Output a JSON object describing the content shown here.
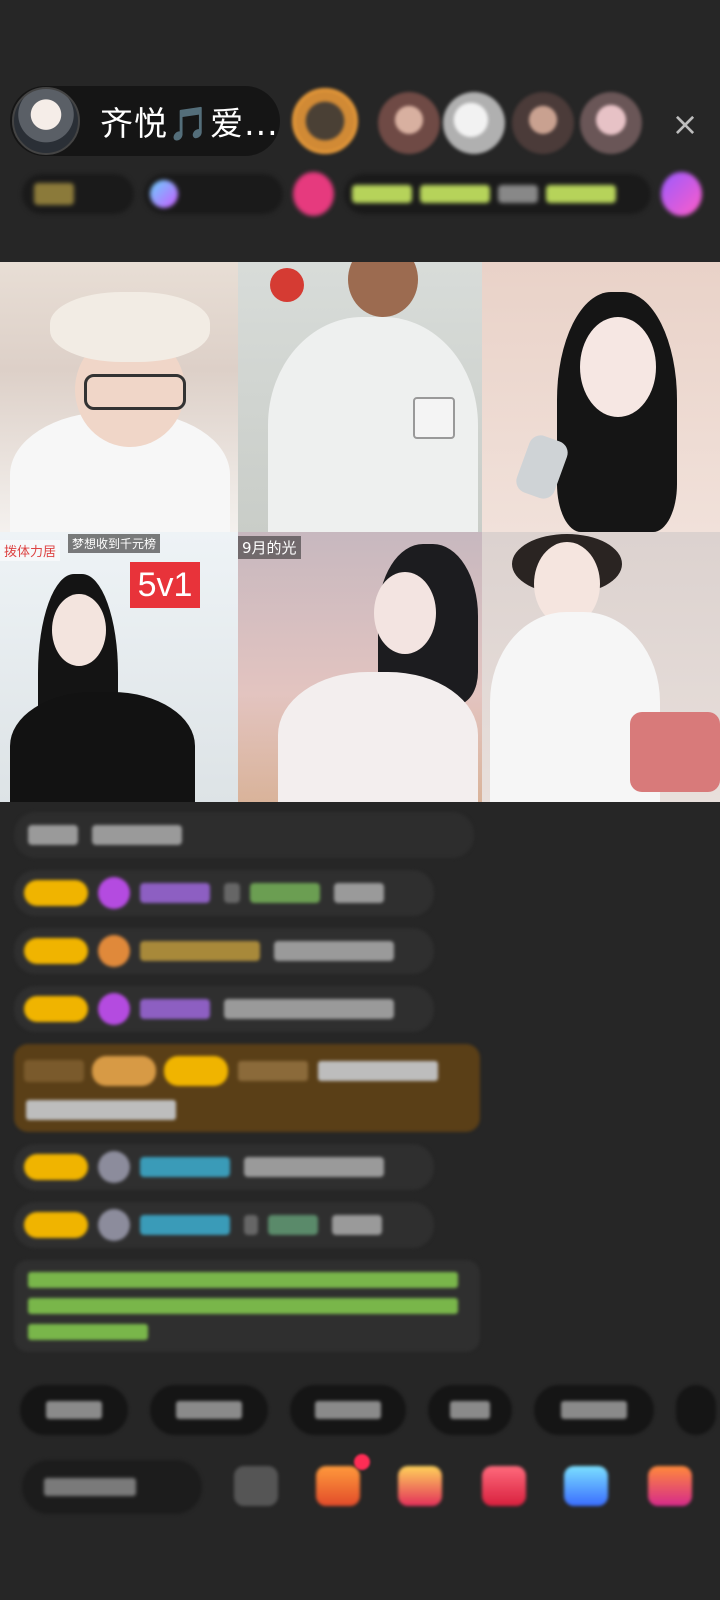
{
  "header": {
    "host_name": "齐悦🎵爱...",
    "close_glyph": "×",
    "viewers": [
      "top-gifter-1",
      "viewer-2",
      "viewer-3",
      "viewer-4",
      "viewer-5"
    ]
  },
  "video_grid": {
    "tiles": [
      {
        "tag": ""
      },
      {
        "tag": ""
      },
      {
        "tag": ""
      },
      {
        "tag_left": "拨体力居",
        "tag_mid": "梦想收到千元榜",
        "badge": "5v1"
      },
      {
        "tag": "9月的光"
      },
      {
        "tag": ""
      }
    ]
  },
  "colors": {
    "background": "#262626",
    "level_badge": "#f0b400",
    "gold_message": "#5a3f17",
    "green_text": "#8fd14f",
    "pk_badge": "#e8333a"
  },
  "icons": [
    "close-icon",
    "heart-gift-icon",
    "gift-box-icon",
    "game-icon",
    "message-icon",
    "more-icon"
  ]
}
